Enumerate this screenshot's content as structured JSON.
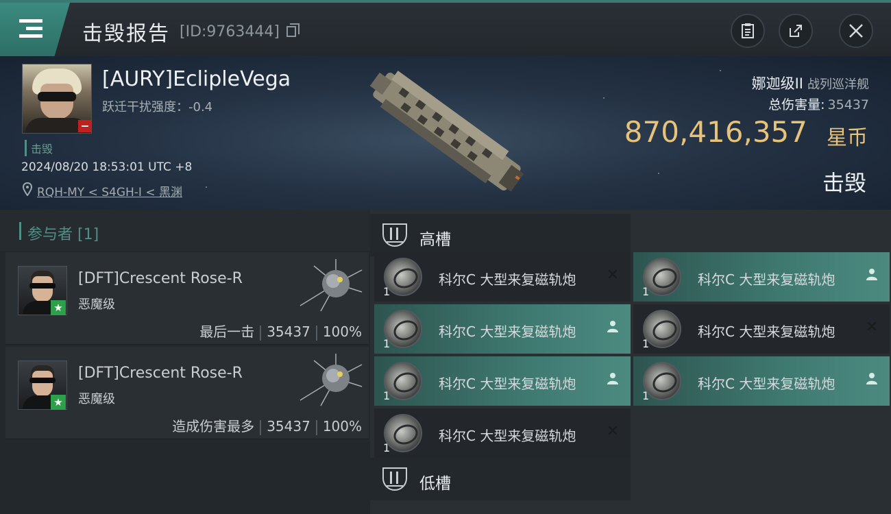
{
  "header": {
    "title": "击毁报告",
    "report_id": "[ID:9763444]"
  },
  "victim": {
    "name": "[AURY]EclipleVega",
    "warp_scramble": "跃迁干扰强度：-0.4",
    "tag": "击毁",
    "timestamp": "2024/08/20 18:53:01 UTC +8",
    "location": "RQH-MY < S4GH-I < 黑渊",
    "ship_class": "娜迦级II",
    "ship_category": "战列巡洋舰",
    "total_damage_label": "总伤害量:",
    "total_damage_value": "35437",
    "isk_value": "870,416,357",
    "isk_unit": "星币",
    "result": "击毁"
  },
  "participants": {
    "title": "参与者 [1]",
    "items": [
      {
        "name": "[DFT]Crescent Rose-R",
        "ship": "恶魔级",
        "role": "最后一击",
        "damage": "35437",
        "percent": "100%",
        "badge": "★"
      },
      {
        "name": "[DFT]Crescent Rose-R",
        "ship": "恶魔级",
        "role": "造成伤害最多",
        "damage": "35437",
        "percent": "100%",
        "badge": "★"
      }
    ]
  },
  "slots": {
    "high": {
      "title": "高槽",
      "modules": [
        {
          "name": "科尔C 大型来复磁轨炮",
          "qty": "1",
          "status": "✕",
          "active": false
        },
        {
          "name": "科尔C 大型来复磁轨炮",
          "qty": "1",
          "status": "pilot",
          "active": true
        },
        {
          "name": "科尔C 大型来复磁轨炮",
          "qty": "1",
          "status": "pilot",
          "active": true
        },
        {
          "name": "科尔C 大型来复磁轨炮",
          "qty": "1",
          "status": "✕",
          "active": false
        },
        {
          "name": "科尔C 大型来复磁轨炮",
          "qty": "1",
          "status": "pilot",
          "active": true
        },
        {
          "name": "科尔C 大型来复磁轨炮",
          "qty": "1",
          "status": "pilot",
          "active": true
        },
        {
          "name": "科尔C 大型来复磁轨炮",
          "qty": "1",
          "status": "✕",
          "active": false
        }
      ]
    },
    "low": {
      "title": "低槽"
    }
  },
  "colors": {
    "accent": "#4f8f84",
    "isk": "#e7c27a",
    "active_slot": "#3f7a71"
  }
}
